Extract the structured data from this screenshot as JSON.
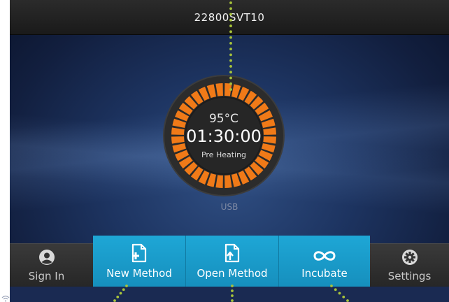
{
  "header": {
    "title": "22800SVT10"
  },
  "dial": {
    "temperature": "95°C",
    "timer": "01:30:00",
    "status": "Pre Heating"
  },
  "usb_label": "USB",
  "bottom_bar": {
    "sign_in": {
      "label": "Sign In",
      "icon": "user-icon"
    },
    "new_method": {
      "label": "New Method",
      "icon": "new-file-icon"
    },
    "open_method": {
      "label": "Open Method",
      "icon": "open-file-icon"
    },
    "incubate": {
      "label": "Incubate",
      "icon": "infinity-icon"
    },
    "settings": {
      "label": "Settings",
      "icon": "gear-icon"
    }
  },
  "colors": {
    "accent": "#1ea7d6",
    "dial_segment": "#f07a18",
    "annotation_dots": "#a8c43a",
    "background": "#1d3461"
  }
}
